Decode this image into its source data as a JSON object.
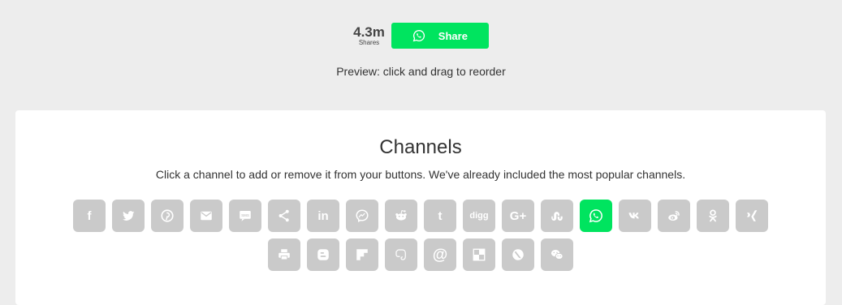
{
  "preview": {
    "count": "4.3m",
    "count_label": "Shares",
    "button_label": "Share",
    "hint": "Preview: click and drag to reorder"
  },
  "card": {
    "title": "Channels",
    "description": "Click a channel to add or remove it from your buttons. We've already included the most popular channels."
  },
  "colors": {
    "accent": "#00e45f",
    "inactive": "#cacaca",
    "background": "#ededed"
  },
  "channels": [
    {
      "icon": "facebook-icon",
      "glyph": "f",
      "selected": false
    },
    {
      "icon": "twitter-icon",
      "glyph": "",
      "selected": false
    },
    {
      "icon": "pinterest-icon",
      "glyph": "",
      "selected": false
    },
    {
      "icon": "email-icon",
      "glyph": "",
      "selected": false
    },
    {
      "icon": "sms-icon",
      "glyph": "",
      "selected": false
    },
    {
      "icon": "share-icon",
      "glyph": "",
      "selected": false
    },
    {
      "icon": "linkedin-icon",
      "glyph": "in",
      "selected": false
    },
    {
      "icon": "messenger-icon",
      "glyph": "",
      "selected": false
    },
    {
      "icon": "reddit-icon",
      "glyph": "",
      "selected": false
    },
    {
      "icon": "tumblr-icon",
      "glyph": "t",
      "selected": false
    },
    {
      "icon": "digg-icon",
      "glyph": "digg",
      "selected": false
    },
    {
      "icon": "google-plus-icon",
      "glyph": "G+",
      "selected": false
    },
    {
      "icon": "stumbleupon-icon",
      "glyph": "",
      "selected": false
    },
    {
      "icon": "whatsapp-icon",
      "glyph": "",
      "selected": true
    },
    {
      "icon": "vk-icon",
      "glyph": "",
      "selected": false
    },
    {
      "icon": "weibo-icon",
      "glyph": "",
      "selected": false
    },
    {
      "icon": "odnoklassniki-icon",
      "glyph": "",
      "selected": false
    },
    {
      "icon": "xing-icon",
      "glyph": "",
      "selected": false
    },
    {
      "icon": "print-icon",
      "glyph": "",
      "selected": false
    },
    {
      "icon": "blogger-icon",
      "glyph": "",
      "selected": false
    },
    {
      "icon": "flipboard-icon",
      "glyph": "",
      "selected": false
    },
    {
      "icon": "evernote-icon",
      "glyph": "",
      "selected": false
    },
    {
      "icon": "at-sign-icon",
      "glyph": "@",
      "selected": false
    },
    {
      "icon": "delicious-icon",
      "glyph": "",
      "selected": false
    },
    {
      "icon": "livejournal-icon",
      "glyph": "",
      "selected": false
    },
    {
      "icon": "wechat-icon",
      "glyph": "",
      "selected": false
    }
  ]
}
